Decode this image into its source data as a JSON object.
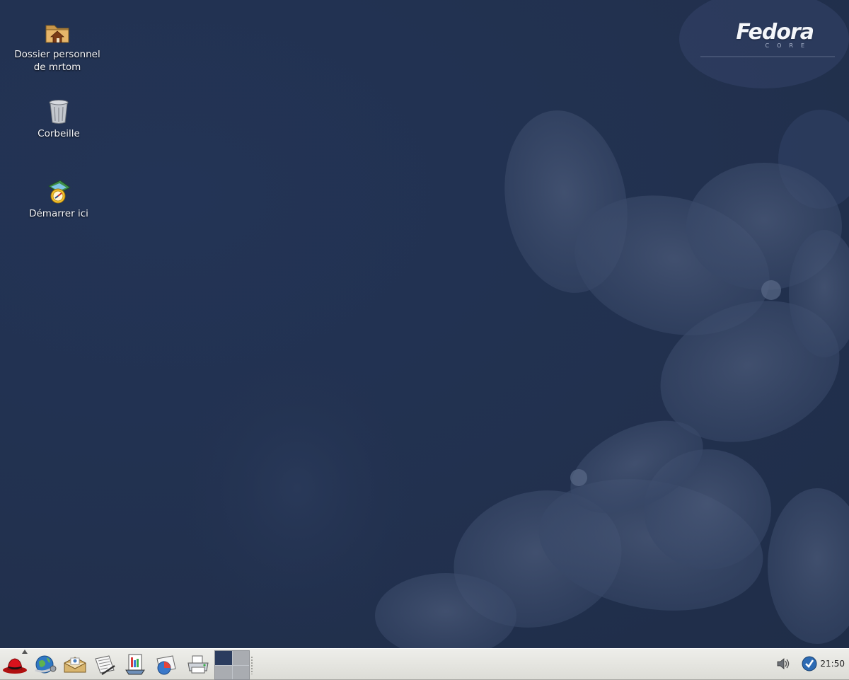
{
  "desktop": {
    "brand": {
      "name": "Fedora",
      "sub": "CORE"
    },
    "icons": [
      {
        "label_line1": "Dossier personnel",
        "label_line2": "de mrtom",
        "icon": "home-folder-icon"
      },
      {
        "label": "Corbeille",
        "icon": "trash-icon"
      },
      {
        "label": "Démarrer ici",
        "icon": "start-here-icon"
      }
    ]
  },
  "taskbar": {
    "launchers": [
      {
        "icon": "redhat-menu-icon"
      },
      {
        "icon": "web-browser-icon"
      },
      {
        "icon": "email-icon"
      },
      {
        "icon": "text-editor-icon"
      },
      {
        "icon": "presentation-icon"
      },
      {
        "icon": "spreadsheet-icon"
      },
      {
        "icon": "printer-icon"
      }
    ],
    "workspaces": {
      "count": 4,
      "active": 1
    },
    "tray": {
      "volume_icon": "volume-icon",
      "update_icon": "update-checkmark-icon",
      "clock": "21:50"
    }
  },
  "colors": {
    "desktop_bg": "#233352",
    "flower_tint": "#3a4a68",
    "taskbar_bg": "#e6e6e1"
  }
}
